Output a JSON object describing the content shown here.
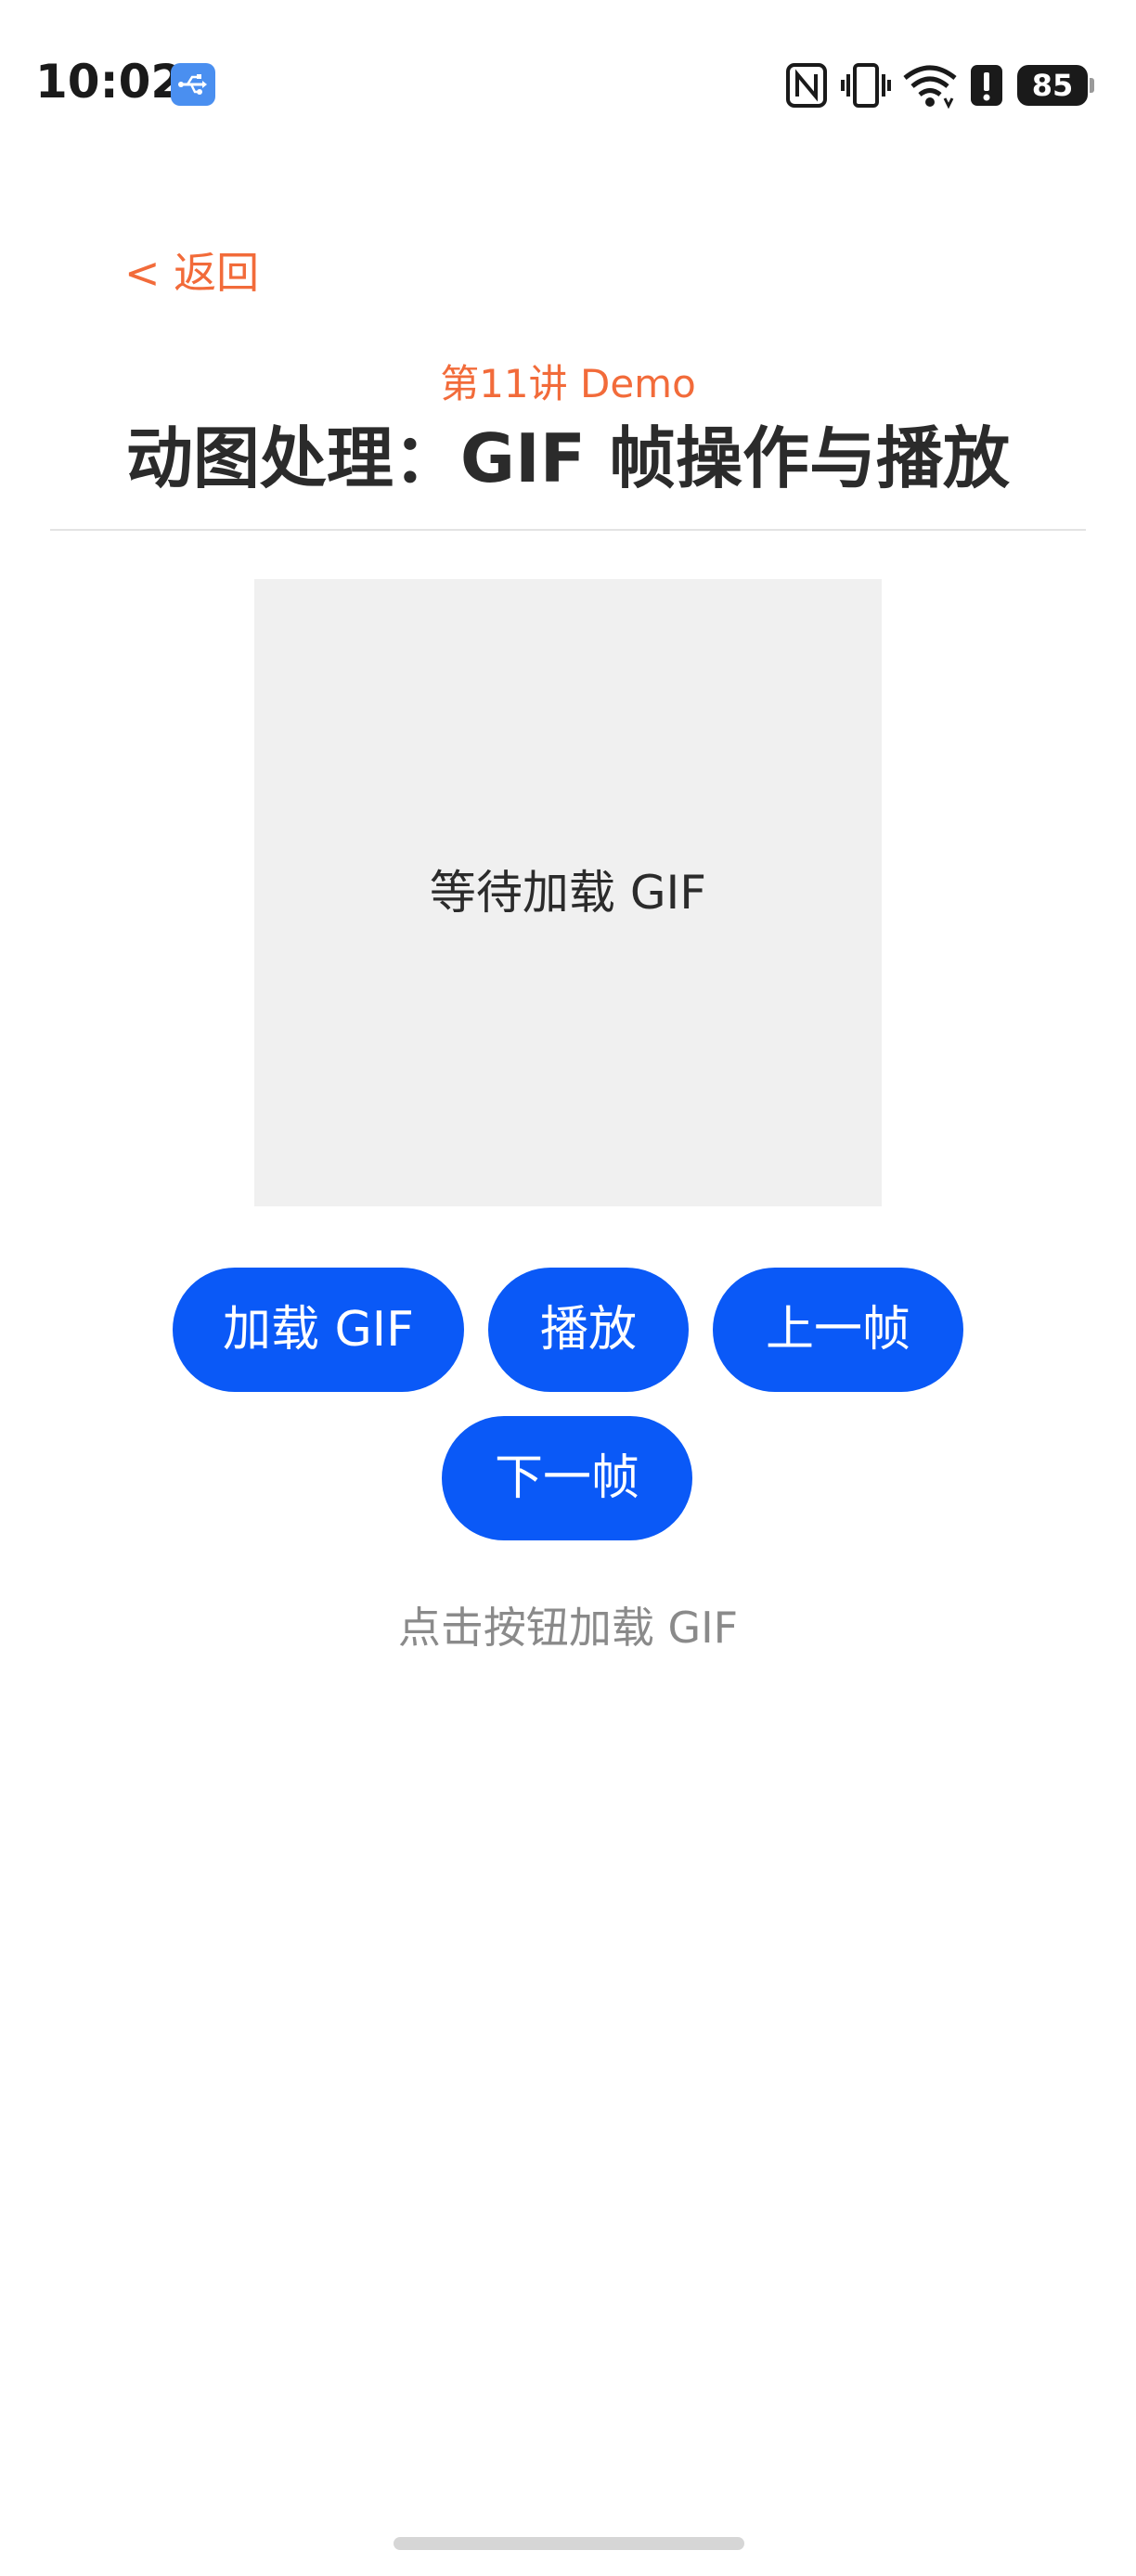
{
  "status_bar": {
    "time": "10:02",
    "battery_level": "85",
    "icons": [
      "usb-icon",
      "nfc-icon",
      "vibrate-icon",
      "wifi-icon",
      "alert-icon",
      "battery-icon"
    ]
  },
  "header": {
    "back_label": "< 返回",
    "subtitle": "第11讲 Demo",
    "title": "动图处理：GIF 帧操作与播放"
  },
  "preview": {
    "placeholder": "等待加载 GIF"
  },
  "controls": {
    "load_label": "加载 GIF",
    "play_label": "播放",
    "prev_label": "上一帧",
    "next_label": "下一帧"
  },
  "status": {
    "hint": "点击按钮加载 GIF"
  },
  "colors": {
    "accent": "#f26b3a",
    "button": "#0a59f7",
    "preview_bg": "#f0f0f0"
  }
}
